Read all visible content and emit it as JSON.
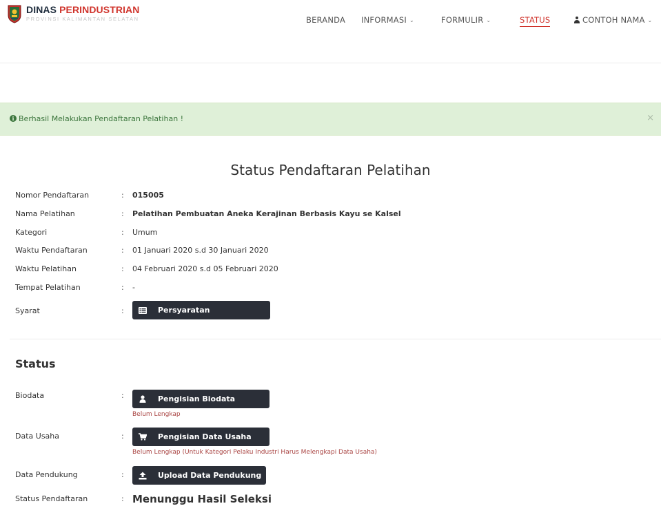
{
  "brand": {
    "title_part1": "DINAS ",
    "title_part2": "PERINDUSTRIAN",
    "subtitle": "PROVINSI KALIMANTAN SELATAN"
  },
  "nav": {
    "items": [
      {
        "label": "BERANDA",
        "has_dropdown": false,
        "active": false
      },
      {
        "label": "INFORMASI",
        "has_dropdown": true,
        "active": false
      },
      {
        "label": "FORMULIR",
        "has_dropdown": true,
        "active": false
      },
      {
        "label": "STATUS",
        "has_dropdown": false,
        "active": true
      },
      {
        "label": "CONTOH NAMA",
        "has_dropdown": true,
        "active": false,
        "icon": "user-icon"
      }
    ]
  },
  "alert": {
    "icon": "info-circle-icon",
    "message": "Berhasil Melakukan Pendaftaran Pelatihan !",
    "close": "×",
    "color": "#dff0d8"
  },
  "page_title": "Status Pendaftaran Pelatihan",
  "details": [
    {
      "label": "Nomor Pendaftaran",
      "value": "015005"
    },
    {
      "label": "Nama Pelatihan",
      "value": "Pelatihan Pembuatan Aneka Kerajinan Berbasis Kayu se Kalsel"
    },
    {
      "label": "Kategori",
      "value": "Umum"
    },
    {
      "label": "Waktu Pendaftaran",
      "value": "01 Januari 2020 s.d 30 Januari 2020"
    },
    {
      "label": "Waktu Pelatihan",
      "value": "04 Februari 2020 s.d 05 Februari 2020"
    },
    {
      "label": "Tempat Pelatihan",
      "value": "-"
    },
    {
      "label": "Syarat",
      "button": "Persyaratan",
      "icon": "list-icon"
    }
  ],
  "colon": ":",
  "status_section": {
    "title": "Status",
    "rows": [
      {
        "label": "Biodata",
        "button": "Pengisian Biodata",
        "icon": "user-icon",
        "note": "Belum Lengkap"
      },
      {
        "label": "Data Usaha",
        "button": "Pengisian Data Usaha",
        "icon": "cart-icon",
        "note": "Belum Lengkap (Untuk Kategori Pelaku Industri Harus Melengkapi Data Usaha)"
      },
      {
        "label": "Data Pendukung",
        "button": "Upload Data Pendukung",
        "icon": "upload-icon"
      },
      {
        "label": "Status Pendaftaran",
        "value": "Menunggu Hasil Seleksi"
      }
    ]
  },
  "colors": {
    "accent": "#d0342c",
    "button_bg": "#2b2f38",
    "note_text": "#a94442",
    "alert_text": "#3c763d"
  }
}
